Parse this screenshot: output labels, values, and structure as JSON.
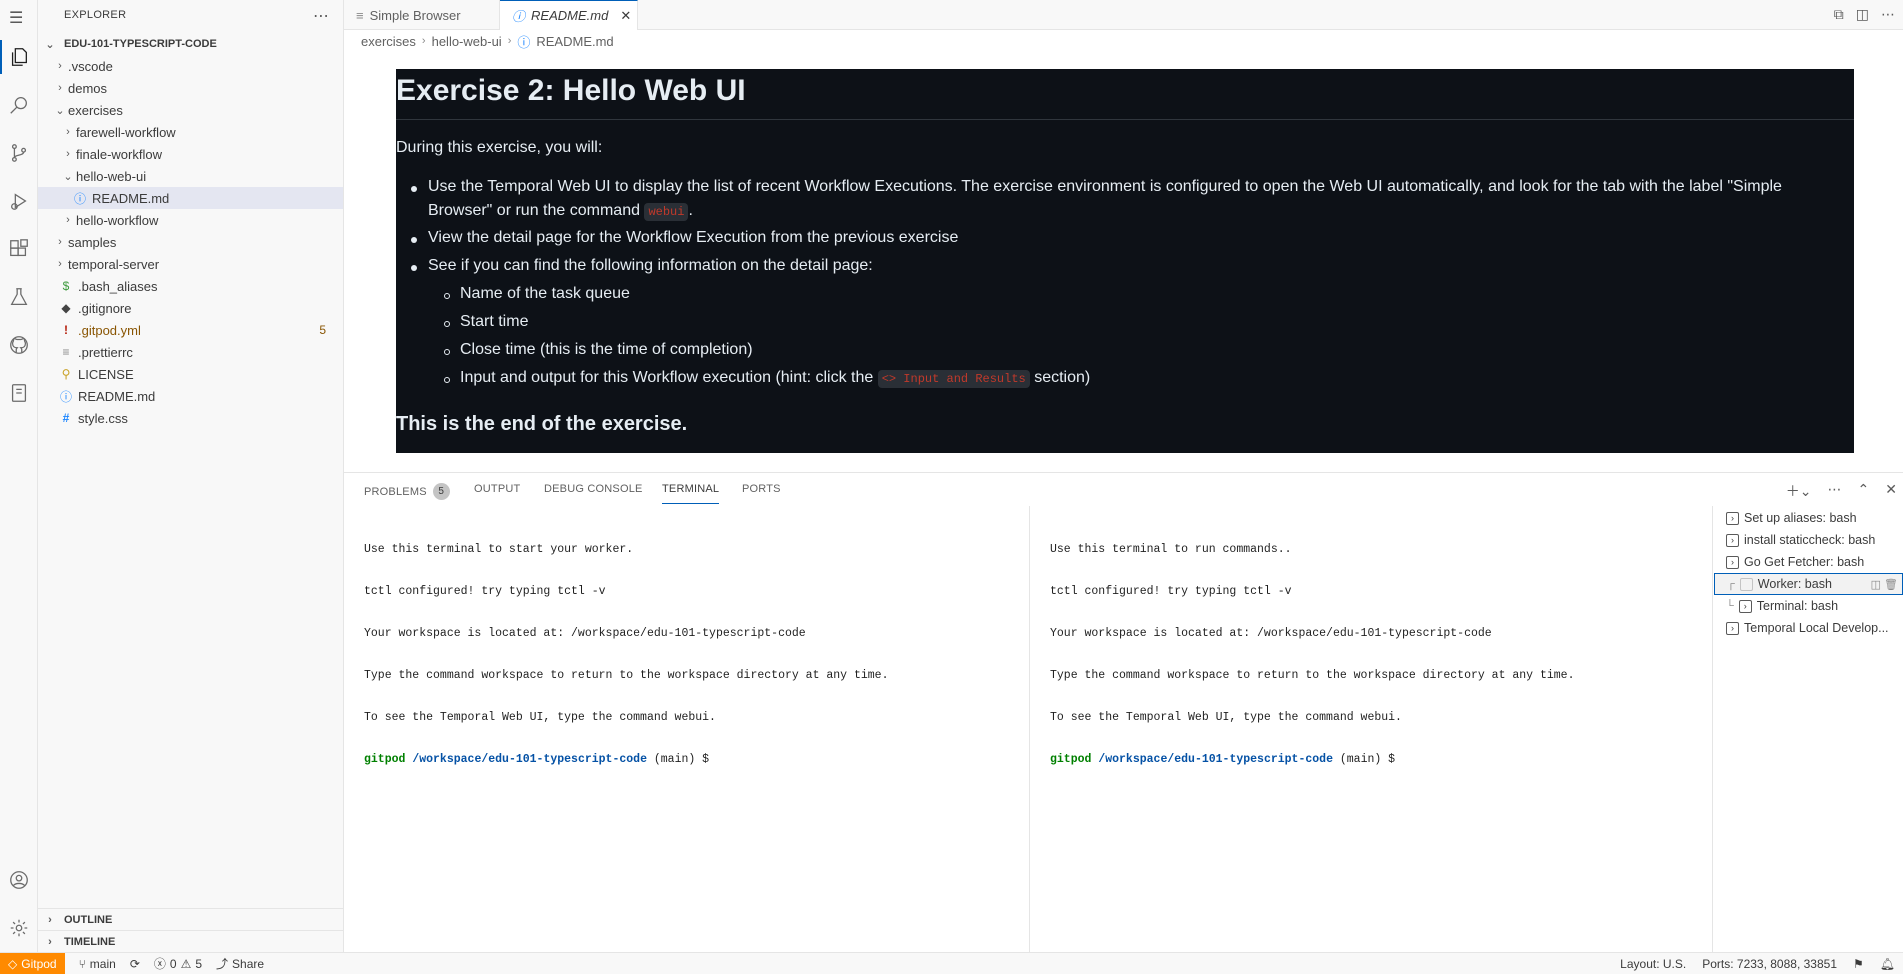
{
  "tabs": {
    "simple_browser": "Simple Browser",
    "readme": "README.md"
  },
  "breadcrumb": [
    "exercises",
    "hello-web-ui",
    "README.md"
  ],
  "explorer": {
    "title": "EXPLORER",
    "root": "EDU-101-TYPESCRIPT-CODE",
    "items": [
      {
        "label": ".vscode",
        "kind": "folder"
      },
      {
        "label": "demos",
        "kind": "folder"
      },
      {
        "label": "exercises",
        "kind": "folder-open"
      },
      {
        "label": "farewell-workflow",
        "kind": "folder"
      },
      {
        "label": "finale-workflow",
        "kind": "folder"
      },
      {
        "label": "hello-web-ui",
        "kind": "folder-open"
      },
      {
        "label": "README.md",
        "kind": "info"
      },
      {
        "label": "hello-workflow",
        "kind": "folder"
      },
      {
        "label": "samples",
        "kind": "folder"
      },
      {
        "label": "temporal-server",
        "kind": "folder"
      },
      {
        "label": ".bash_aliases",
        "kind": "dollar"
      },
      {
        "label": ".gitignore",
        "kind": "git"
      },
      {
        "label": ".gitpod.yml",
        "kind": "bang"
      },
      {
        "label": ".prettierrc",
        "kind": "lines"
      },
      {
        "label": "LICENSE",
        "kind": "license"
      },
      {
        "label": "README.md",
        "kind": "info"
      },
      {
        "label": "style.css",
        "kind": "hash"
      }
    ],
    "gitpod_problems": "5",
    "outline": "OUTLINE",
    "timeline": "TIMELINE"
  },
  "readme": {
    "title": "Exercise 2: Hello Web UI",
    "intro": "During this exercise, you will:",
    "bullet1_a": "Use the Temporal Web UI to display the list of recent Workflow Executions. The exercise environment is configured to open the Web UI automatically, and look for the tab with the label \"Simple",
    "bullet1_b": "Browser\" or run the command",
    "bullet1_code": "webui",
    "bullet1_end": ".",
    "bullet2": "View the detail page for the Workflow Execution from the previous exercise",
    "bullet3": "See if you can find the following information on the detail page:",
    "sub1": "Name of the task queue",
    "sub2": "Start time",
    "sub3": "Close time (this is the time of completion)",
    "sub4_a": "Input and output for this Workflow execution (hint: click the",
    "sub4_code": "<> Input and Results",
    "sub4_b": "section)",
    "end": "This is the end of the exercise."
  },
  "panel": {
    "problems": "PROBLEMS",
    "problems_count": "5",
    "output": "OUTPUT",
    "debug_console": "DEBUG CONSOLE",
    "terminal": "TERMINAL",
    "ports": "PORTS"
  },
  "terminal_left": {
    "lines": [
      "Use this terminal to start your worker.",
      "tctl configured! try typing tctl -v",
      "Your workspace is located at: /workspace/edu-101-typescript-code",
      "Type the command workspace to return to the workspace directory at any time.",
      "To see the Temporal Web UI, type the command webui."
    ],
    "prompt_user": "gitpod",
    "prompt_path": "/workspace/edu-101-typescript-code",
    "prompt_rest": " (main) $"
  },
  "terminal_right": {
    "lines": [
      "Use this terminal to run commands..",
      "tctl configured! try typing tctl -v",
      "Your workspace is located at: /workspace/edu-101-typescript-code",
      "Type the command workspace to return to the workspace directory at any time.",
      "To see the Temporal Web UI, type the command webui."
    ],
    "prompt_user": "gitpod",
    "prompt_path": "/workspace/edu-101-typescript-code",
    "prompt_rest": " (main) $"
  },
  "terminal_list": [
    "Set up aliases: bash",
    "install staticcheck: bash",
    "Go Get Fetcher: bash",
    "Worker: bash",
    "Terminal: bash",
    "Temporal Local Develop..."
  ],
  "status": {
    "gitpod": "Gitpod",
    "branch": "main",
    "errors": "0",
    "warnings": "5",
    "share": "Share",
    "layout": "Layout: U.S.",
    "ports": "Ports: 7233, 8088, 33851"
  }
}
